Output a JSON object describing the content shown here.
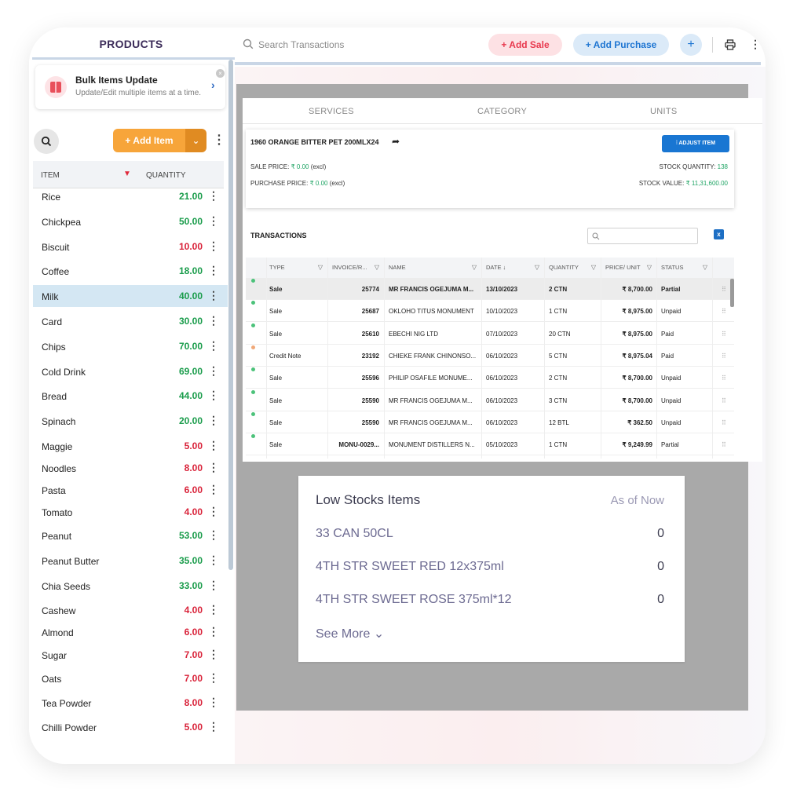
{
  "sidebar": {
    "title": "PRODUCTS",
    "bulk": {
      "title": "Bulk Items Update",
      "subtitle": "Update/Edit multiple items at a time."
    },
    "add_item_label": "+  Add Item",
    "header": {
      "item": "ITEM",
      "quantity": "QUANTITY"
    },
    "items": [
      {
        "name": "Rice",
        "qty": "21.00",
        "color": "#1a9c4b"
      },
      {
        "name": "Chickpea",
        "qty": "50.00",
        "color": "#1a9c4b"
      },
      {
        "name": "Biscuit",
        "qty": "10.00",
        "color": "#d9233a"
      },
      {
        "name": "Coffee",
        "qty": "18.00",
        "color": "#1a9c4b"
      },
      {
        "name": "Milk",
        "qty": "40.00",
        "color": "#1a9c4b"
      },
      {
        "name": "Card",
        "qty": "30.00",
        "color": "#1a9c4b"
      },
      {
        "name": "Chips",
        "qty": "70.00",
        "color": "#1a9c4b"
      },
      {
        "name": "Cold Drink",
        "qty": "69.00",
        "color": "#1a9c4b"
      },
      {
        "name": "Bread",
        "qty": "44.00",
        "color": "#1a9c4b"
      },
      {
        "name": "Spinach",
        "qty": "20.00",
        "color": "#1a9c4b"
      },
      {
        "name": "Maggie",
        "qty": "5.00",
        "color": "#d9233a"
      },
      {
        "name": "Noodles",
        "qty": "8.00",
        "color": "#d9233a"
      },
      {
        "name": "Pasta",
        "qty": "6.00",
        "color": "#d9233a"
      },
      {
        "name": "Tomato",
        "qty": "4.00",
        "color": "#d9233a"
      },
      {
        "name": "Peanut",
        "qty": "53.00",
        "color": "#1a9c4b"
      },
      {
        "name": "Peanut Butter",
        "qty": "35.00",
        "color": "#1a9c4b"
      },
      {
        "name": "Chia Seeds",
        "qty": "33.00",
        "color": "#1a9c4b"
      },
      {
        "name": "Cashew",
        "qty": "4.00",
        "color": "#d9233a"
      },
      {
        "name": "Almond",
        "qty": "6.00",
        "color": "#d9233a"
      },
      {
        "name": "Sugar",
        "qty": "7.00",
        "color": "#d9233a"
      },
      {
        "name": "Oats",
        "qty": "7.00",
        "color": "#d9233a"
      },
      {
        "name": "Tea Powder",
        "qty": "8.00",
        "color": "#d9233a"
      },
      {
        "name": "Chilli Powder",
        "qty": "5.00",
        "color": "#d9233a"
      }
    ]
  },
  "topbar": {
    "search_placeholder": "Search Transactions",
    "add_sale": "+ Add Sale",
    "add_purchase": "+ Add Purchase",
    "plus": "+"
  },
  "tabs": [
    "SERVICES",
    "CATEGORY",
    "UNITS"
  ],
  "product": {
    "name": "1960 ORANGE BITTER PET 200MLX24",
    "adjust_label": "ADJUST ITEM",
    "sale_price_label": "SALE PRICE: ",
    "sale_price_value": "₹ 0.00",
    "sale_price_suffix": " (excl)",
    "purchase_price_label": "PURCHASE PRICE: ",
    "purchase_price_value": "₹ 0.00",
    "purchase_price_suffix": " (excl)",
    "stock_qty_label": "STOCK QUANTITY: ",
    "stock_qty_value": "138",
    "stock_value_label": "STOCK VALUE: ",
    "stock_value_value": "₹ 11,31,600.00"
  },
  "transactions": {
    "title": "TRANSACTIONS",
    "columns": [
      "TYPE",
      "INVOICE/R...",
      "NAME",
      "DATE",
      "QUANTITY",
      "PRICE/ UNIT",
      "STATUS"
    ],
    "rows": [
      {
        "type": "Sale",
        "invoice": "25774",
        "name": "MR FRANCIS OGEJUMA M...",
        "date": "13/10/2023",
        "qty": "2 CTN",
        "price": "₹ 8,700.00",
        "status": "Partial",
        "dot": "#4cc27a"
      },
      {
        "type": "Sale",
        "invoice": "25687",
        "name": "OKLOHO TITUS MONUMENT",
        "date": "10/10/2023",
        "qty": "1 CTN",
        "price": "₹ 8,975.00",
        "status": "Unpaid",
        "dot": "#4cc27a"
      },
      {
        "type": "Sale",
        "invoice": "25610",
        "name": "EBECHI NIG LTD",
        "date": "07/10/2023",
        "qty": "20 CTN",
        "price": "₹ 8,975.00",
        "status": "Paid",
        "dot": "#4cc27a"
      },
      {
        "type": "Credit Note",
        "invoice": "23192",
        "name": "CHIEKE FRANK CHINONSO...",
        "date": "06/10/2023",
        "qty": "5 CTN",
        "price": "₹ 8,975.04",
        "status": "Paid",
        "dot": "#f0a878"
      },
      {
        "type": "Sale",
        "invoice": "25596",
        "name": "PHILIP OSAFILE MONUME...",
        "date": "06/10/2023",
        "qty": "2 CTN",
        "price": "₹ 8,700.00",
        "status": "Unpaid",
        "dot": "#4cc27a"
      },
      {
        "type": "Sale",
        "invoice": "25590",
        "name": "MR FRANCIS OGEJUMA M...",
        "date": "06/10/2023",
        "qty": "3 CTN",
        "price": "₹ 8,700.00",
        "status": "Unpaid",
        "dot": "#4cc27a"
      },
      {
        "type": "Sale",
        "invoice": "25590",
        "name": "MR FRANCIS OGEJUMA M...",
        "date": "06/10/2023",
        "qty": "12 BTL",
        "price": "₹ 362.50",
        "status": "Unpaid",
        "dot": "#4cc27a"
      },
      {
        "type": "Sale",
        "invoice": "MONU-0029...",
        "name": "MONUMENT DISTILLERS N...",
        "date": "05/10/2023",
        "qty": "1 CTN",
        "price": "₹ 9,249.99",
        "status": "Partial",
        "dot": "#4cc27a"
      }
    ]
  },
  "low_stock": {
    "title": "Low Stocks Items",
    "as_of": "As of Now",
    "items": [
      {
        "name": "33 CAN 50CL",
        "value": "0"
      },
      {
        "name": "4TH STR SWEET RED 12x375ml",
        "value": "0"
      },
      {
        "name": "4TH STR SWEET ROSE 375ml*12",
        "value": "0"
      }
    ],
    "see_more": "See More"
  }
}
